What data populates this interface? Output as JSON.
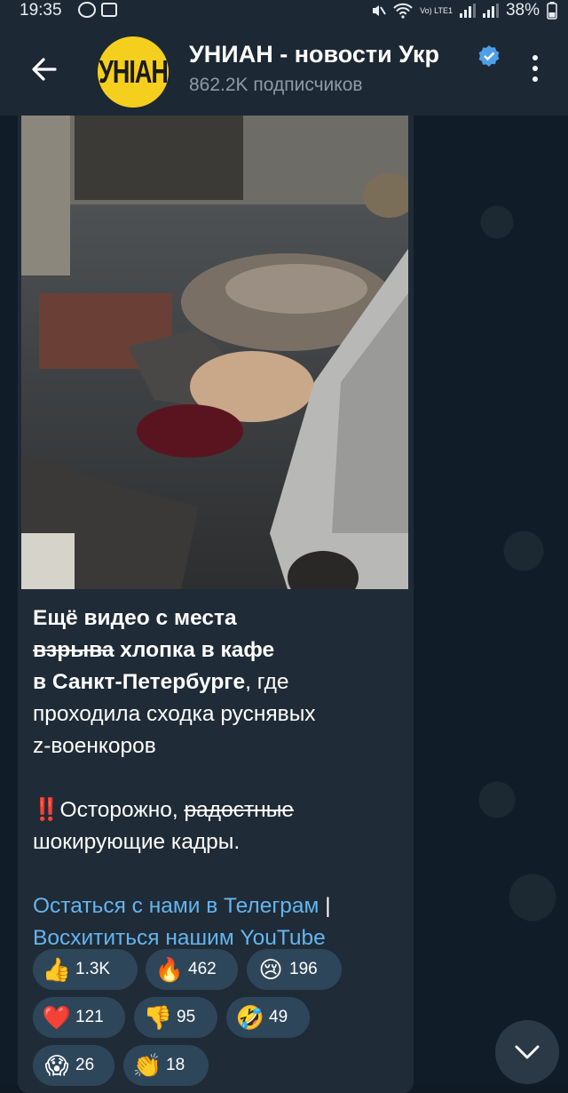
{
  "status_bar": {
    "time": "19:35",
    "network_label": "Vo) LTE1",
    "battery": "38%"
  },
  "header": {
    "back_icon": "arrow-left-icon",
    "avatar_text": "УНIАН",
    "title": "УНИАН - новости Укр",
    "subtitle": "862.2K подписчиков",
    "verified_icon": "verified-badge-icon",
    "menu_icon": "more-vertical-icon"
  },
  "message": {
    "line1": "Ещё видео с места",
    "line2_strike": "взрыва",
    "line2_rest": " хлопка в кафе",
    "line3_bold": "в Санкт-Петербурге",
    "line3_rest": ", где",
    "line4": "проходила сходка руснявых",
    "line5": "z-военкоров",
    "warning_emoji": "‼️",
    "warning_text": "Осторожно, ",
    "warning_strike": "радостные",
    "warning_line2": "шокирующие кадры.",
    "link1": "Остаться с нами в Телеграм",
    "separator": " | ",
    "link2": "Восхититься нашим YouTube"
  },
  "reactions": [
    {
      "emoji": "👍",
      "count": "1.3K"
    },
    {
      "emoji": "🔥",
      "count": "462"
    },
    {
      "emoji": "😢",
      "count": "196"
    },
    {
      "emoji": "❤️",
      "count": "121"
    },
    {
      "emoji": "👎",
      "count": "95"
    },
    {
      "emoji": "🤣",
      "count": "49"
    },
    {
      "emoji": "😱",
      "count": "26"
    },
    {
      "emoji": "👏",
      "count": "18"
    }
  ],
  "colors": {
    "header_bg": "#1c2834",
    "bubble_bg": "#1f2b37",
    "link": "#64b5ef",
    "avatar_bg": "#f5cf1d",
    "reaction_bg": "#2e4659"
  }
}
